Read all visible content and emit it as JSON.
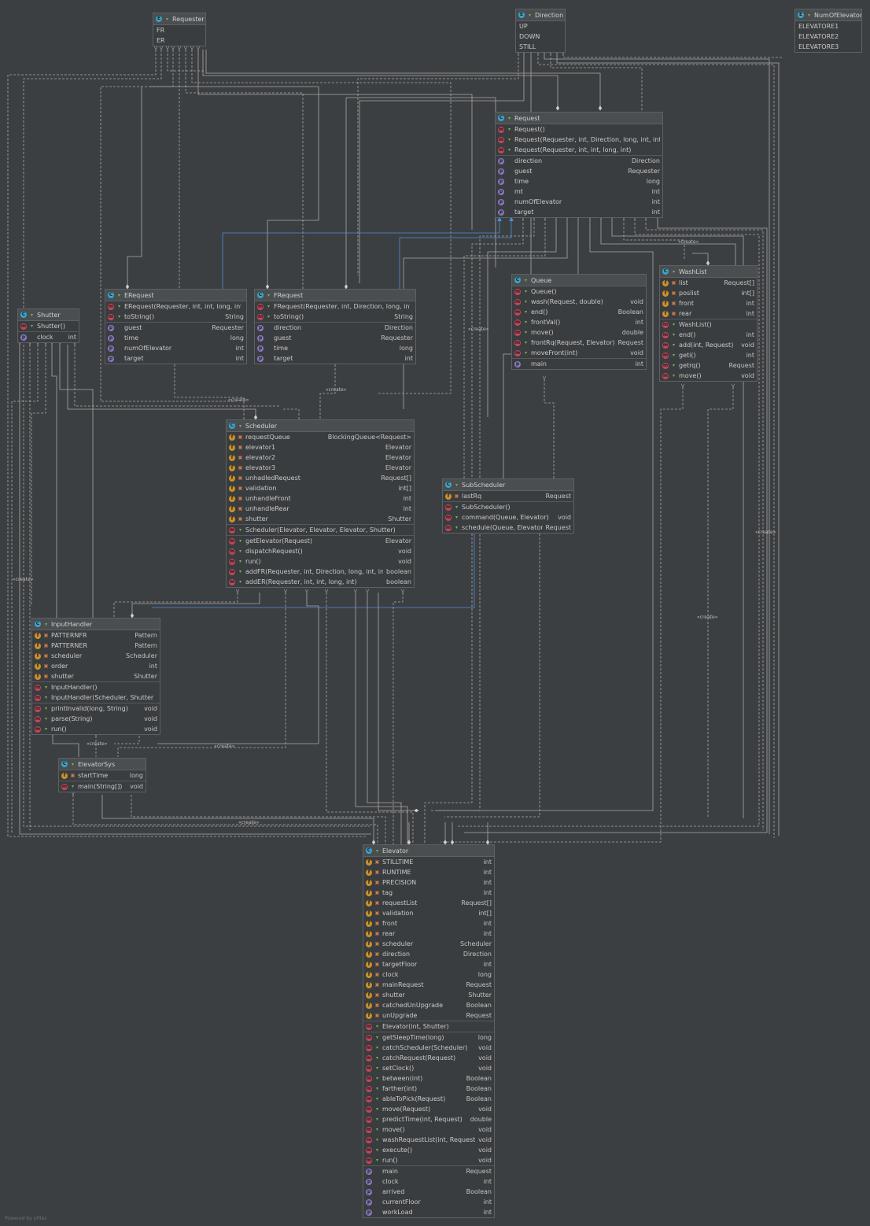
{
  "footer": "Powered by yFiles",
  "create_label": "«create»",
  "classes": {
    "requester": {
      "title": "Requester",
      "constants": [
        "FR",
        "ER"
      ]
    },
    "direction": {
      "title": "Direction",
      "constants": [
        "UP",
        "DOWN",
        "STILL"
      ]
    },
    "num_of_elevator": {
      "title": "NumOfElevator",
      "constants": [
        "ELEVATORE1",
        "ELEVATORE2",
        "ELEVATORE3"
      ]
    },
    "request": {
      "title": "Request",
      "methods": [
        "Request()",
        "Request(Requester, int, Direction, long, int, int)",
        "Request(Requester, int, int, long, int)"
      ],
      "properties": [
        {
          "name": "direction",
          "type": "Direction"
        },
        {
          "name": "guest",
          "type": "Requester"
        },
        {
          "name": "time",
          "type": "long"
        },
        {
          "name": "mt",
          "type": "int"
        },
        {
          "name": "numOfElevator",
          "type": "int"
        },
        {
          "name": "target",
          "type": "int"
        }
      ]
    },
    "erequest": {
      "title": "ERequest",
      "methods": [
        {
          "name": "ERequest(Requester, int, int, long, int)",
          "type": ""
        },
        {
          "name": "toString()",
          "type": "String"
        }
      ],
      "properties": [
        {
          "name": "guest",
          "type": "Requester"
        },
        {
          "name": "time",
          "type": "long"
        },
        {
          "name": "numOfElevator",
          "type": "int"
        },
        {
          "name": "target",
          "type": "int"
        }
      ]
    },
    "frequest": {
      "title": "FRequest",
      "methods": [
        {
          "name": "FRequest(Requester, int, Direction, long, int)",
          "type": ""
        },
        {
          "name": "toString()",
          "type": "String"
        }
      ],
      "properties": [
        {
          "name": "direction",
          "type": "Direction"
        },
        {
          "name": "guest",
          "type": "Requester"
        },
        {
          "name": "time",
          "type": "long"
        },
        {
          "name": "target",
          "type": "int"
        }
      ]
    },
    "queue": {
      "title": "Queue",
      "methods": [
        {
          "name": "Queue()",
          "type": ""
        },
        {
          "name": "wash(Request, double)",
          "type": "void"
        },
        {
          "name": "end()",
          "type": "Boolean"
        },
        {
          "name": "frontVal()",
          "type": "int"
        },
        {
          "name": "move()",
          "type": "double"
        },
        {
          "name": "frontRq(Request, Elevator)",
          "type": "Request"
        },
        {
          "name": "moveFront(int)",
          "type": "void"
        }
      ],
      "properties": [
        {
          "name": "main",
          "type": "int"
        }
      ]
    },
    "washlist": {
      "title": "WashList",
      "fields": [
        {
          "name": "list",
          "type": "Request[]"
        },
        {
          "name": "poslist",
          "type": "int[]"
        },
        {
          "name": "front",
          "type": "int"
        },
        {
          "name": "rear",
          "type": "int"
        }
      ],
      "methods": [
        {
          "name": "WashList()",
          "type": ""
        },
        {
          "name": "end()",
          "type": "int"
        },
        {
          "name": "add(int, Request)",
          "type": "void"
        },
        {
          "name": "geti()",
          "type": "int"
        },
        {
          "name": "getrq()",
          "type": "Request"
        },
        {
          "name": "move()",
          "type": "void"
        }
      ]
    },
    "shutter": {
      "title": "Shutter",
      "methods": [
        {
          "name": "Shutter()",
          "type": ""
        }
      ],
      "properties": [
        {
          "name": "clock",
          "type": "int"
        }
      ]
    },
    "scheduler": {
      "title": "Scheduler",
      "fields": [
        {
          "name": "requestQueue",
          "type": "BlockingQueue<Request>"
        },
        {
          "name": "elevator1",
          "type": "Elevator"
        },
        {
          "name": "elevator2",
          "type": "Elevator"
        },
        {
          "name": "elevator3",
          "type": "Elevator"
        },
        {
          "name": "unhadledRequest",
          "type": "Request[]"
        },
        {
          "name": "validation",
          "type": "int[]"
        },
        {
          "name": "unhandleFront",
          "type": "int"
        },
        {
          "name": "unhandleRear",
          "type": "int"
        },
        {
          "name": "shutter",
          "type": "Shutter"
        }
      ],
      "constructors": [
        {
          "name": "Scheduler(Elevator, Elevator, Elevator, Shutter)",
          "type": ""
        }
      ],
      "methods": [
        {
          "name": "getElevator(Request)",
          "type": "Elevator"
        },
        {
          "name": "dispatchRequest()",
          "type": "void"
        },
        {
          "name": "run()",
          "type": "void"
        },
        {
          "name": "addFR(Requester, int, Direction, long, int, int)",
          "type": "boolean"
        },
        {
          "name": "addER(Requester, int, int, long, int)",
          "type": "boolean"
        }
      ]
    },
    "subscheduler": {
      "title": "SubScheduler",
      "fields": [
        {
          "name": "lastRq",
          "type": "Request"
        }
      ],
      "methods": [
        {
          "name": "SubScheduler()",
          "type": ""
        },
        {
          "name": "command(Queue, Elevator)",
          "type": "void"
        },
        {
          "name": "schedule(Queue, Elevator)",
          "type": "Request"
        }
      ]
    },
    "inputhandler": {
      "title": "InputHandler",
      "fields": [
        {
          "name": "PATTERNFR",
          "type": "Pattern"
        },
        {
          "name": "PATTERNER",
          "type": "Pattern"
        },
        {
          "name": "scheduler",
          "type": "Scheduler"
        },
        {
          "name": "order",
          "type": "int"
        },
        {
          "name": "shutter",
          "type": "Shutter"
        }
      ],
      "constructors": [
        {
          "name": "InputHandler()",
          "type": ""
        },
        {
          "name": "InputHandler(Scheduler, Shutter)",
          "type": ""
        }
      ],
      "methods": [
        {
          "name": "printInvalid(long, String)",
          "type": "void"
        },
        {
          "name": "parse(String)",
          "type": "void"
        },
        {
          "name": "run()",
          "type": "void"
        }
      ]
    },
    "elevatorsys": {
      "title": "ElevatorSys",
      "fields": [
        {
          "name": "startTime",
          "type": "long"
        }
      ],
      "methods": [
        {
          "name": "main(String[])",
          "type": "void"
        }
      ]
    },
    "elevator": {
      "title": "Elevator",
      "fields": [
        {
          "name": "STILLTIME",
          "type": "int"
        },
        {
          "name": "RUNTIME",
          "type": "int"
        },
        {
          "name": "PRECISION",
          "type": "int"
        },
        {
          "name": "tag",
          "type": "int"
        },
        {
          "name": "requestList",
          "type": "Request[]"
        },
        {
          "name": "validation",
          "type": "int[]"
        },
        {
          "name": "front",
          "type": "int"
        },
        {
          "name": "rear",
          "type": "int"
        },
        {
          "name": "scheduler",
          "type": "Scheduler"
        },
        {
          "name": "direction",
          "type": "Direction"
        },
        {
          "name": "targetFloor",
          "type": "int"
        },
        {
          "name": "clock",
          "type": "long"
        },
        {
          "name": "mainRequest",
          "type": "Request"
        },
        {
          "name": "shutter",
          "type": "Shutter"
        },
        {
          "name": "catchedUnUpgrade",
          "type": "Boolean"
        },
        {
          "name": "unUpgrade",
          "type": "Request"
        }
      ],
      "constructors": [
        {
          "name": "Elevator(int, Shutter)",
          "type": ""
        }
      ],
      "methods": [
        {
          "name": "getSleepTime(long)",
          "type": "long"
        },
        {
          "name": "catchScheduler(Scheduler)",
          "type": "void"
        },
        {
          "name": "catchRequest(Request)",
          "type": "void"
        },
        {
          "name": "setClock()",
          "type": "void"
        },
        {
          "name": "between(int)",
          "type": "Boolean"
        },
        {
          "name": "farther(int)",
          "type": "Boolean"
        },
        {
          "name": "ableToPick(Request)",
          "type": "Boolean"
        },
        {
          "name": "move(Request)",
          "type": "void"
        },
        {
          "name": "predictTime(int, Request)",
          "type": "double"
        },
        {
          "name": "move()",
          "type": "void"
        },
        {
          "name": "washRequestList(int, Request)",
          "type": "void"
        },
        {
          "name": "execute()",
          "type": "void"
        },
        {
          "name": "run()",
          "type": "void"
        }
      ],
      "properties": [
        {
          "name": "main",
          "type": "Request"
        },
        {
          "name": "clock",
          "type": "int"
        },
        {
          "name": "arrived",
          "type": "Boolean"
        },
        {
          "name": "currentFloor",
          "type": "int"
        },
        {
          "name": "workLoad",
          "type": "int"
        }
      ]
    }
  },
  "colors": {
    "background": "#3c3f41",
    "wire": "#a8a8a8",
    "inherit": "#4f8fd6",
    "header": "#4a4e50"
  }
}
